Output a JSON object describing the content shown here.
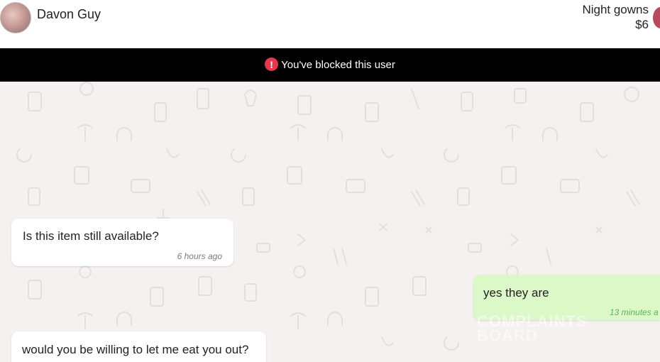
{
  "header": {
    "contact_name": "Davon Guy",
    "product_title": "Night gowns",
    "product_price": "$6"
  },
  "banner": {
    "icon": "exclamation-circle-icon",
    "text": "You've blocked this user",
    "background": "#000000",
    "icon_color": "#e8364b"
  },
  "messages": [
    {
      "direction": "incoming",
      "text": "Is this item still available?",
      "time": "6 hours ago"
    },
    {
      "direction": "outgoing",
      "text": "yes they are",
      "time": "13 minutes a"
    },
    {
      "direction": "incoming",
      "text": "would you be willing to let me eat you out?",
      "time": ""
    }
  ],
  "watermark": {
    "line1": "COMPLAINTS",
    "line2": "BOARD"
  },
  "colors": {
    "chat_background": "#f4f1f0",
    "incoming_bubble": "#ffffff",
    "outgoing_bubble": "#dcf8c6",
    "outgoing_time": "#5ab55a"
  }
}
